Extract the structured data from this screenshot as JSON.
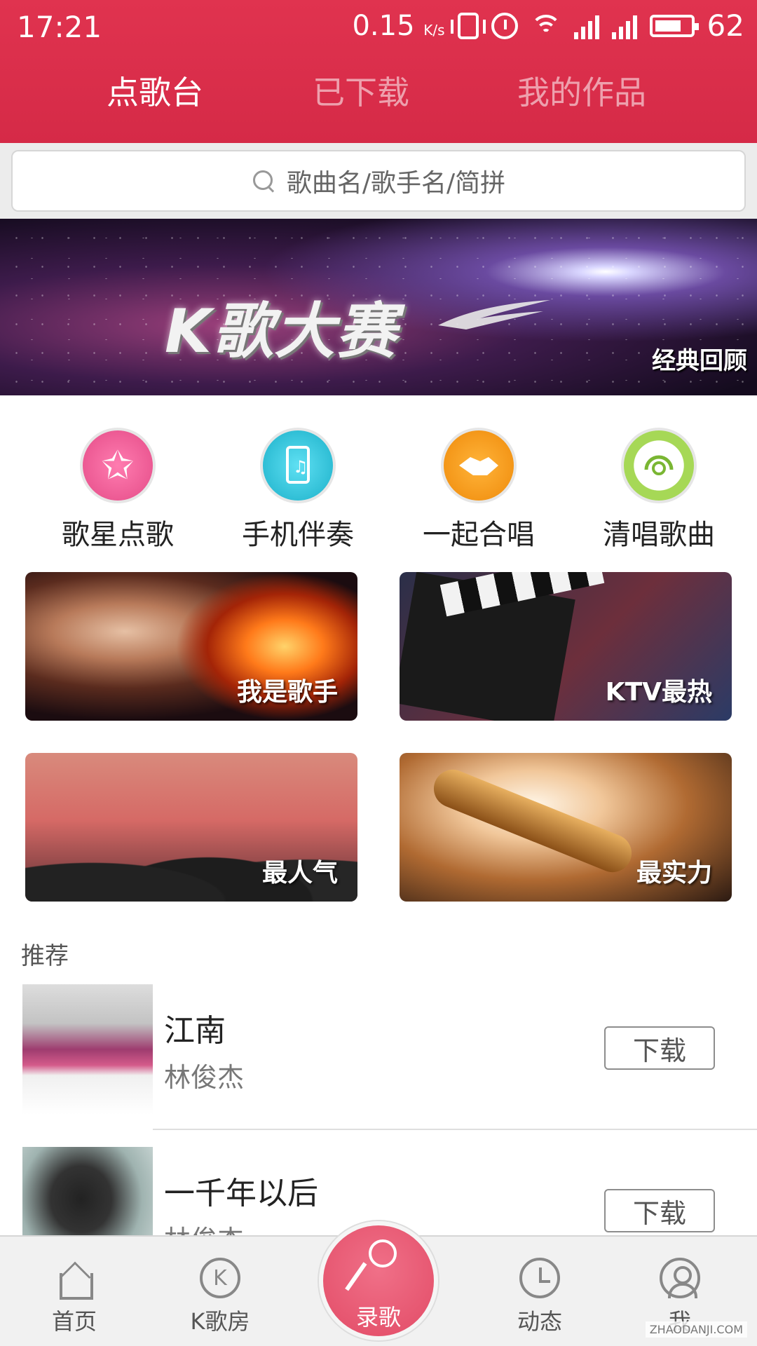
{
  "status": {
    "time": "17:21",
    "speed": "0.15",
    "speed_unit": "K/s",
    "battery": "62"
  },
  "tabs": [
    {
      "label": "点歌台",
      "active": true
    },
    {
      "label": "已下载",
      "active": false
    },
    {
      "label": "我的作品",
      "active": false
    }
  ],
  "search": {
    "placeholder": "歌曲名/歌手名/简拼"
  },
  "banner": {
    "title": "K歌大赛",
    "subtitle": "经典回顾"
  },
  "categories": [
    {
      "label": "歌星点歌",
      "icon": "star-icon"
    },
    {
      "label": "手机伴奏",
      "icon": "phone-music-icon"
    },
    {
      "label": "一起合唱",
      "icon": "handshake-icon"
    },
    {
      "label": "清唱歌曲",
      "icon": "headphones-icon"
    }
  ],
  "tiles": [
    {
      "label": "我是歌手"
    },
    {
      "label": "KTV最热"
    },
    {
      "label": "最人气"
    },
    {
      "label": "最实力"
    }
  ],
  "recommend": {
    "title": "推荐",
    "songs": [
      {
        "name": "江南",
        "artist": "林俊杰",
        "action": "下载"
      },
      {
        "name": "一千年以后",
        "artist": "林俊杰",
        "action": "下载"
      }
    ]
  },
  "bottom_nav": [
    {
      "label": "首页",
      "icon": "home-icon"
    },
    {
      "label": "K歌房",
      "icon": "k-room-icon"
    },
    {
      "label": "录歌",
      "icon": "microphone-icon"
    },
    {
      "label": "动态",
      "icon": "clock-icon"
    },
    {
      "label": "我",
      "icon": "user-icon"
    }
  ],
  "watermark": "ZHAODANJI.COM",
  "colors": {
    "brand": "#d52a47",
    "record": "#e24b66"
  }
}
